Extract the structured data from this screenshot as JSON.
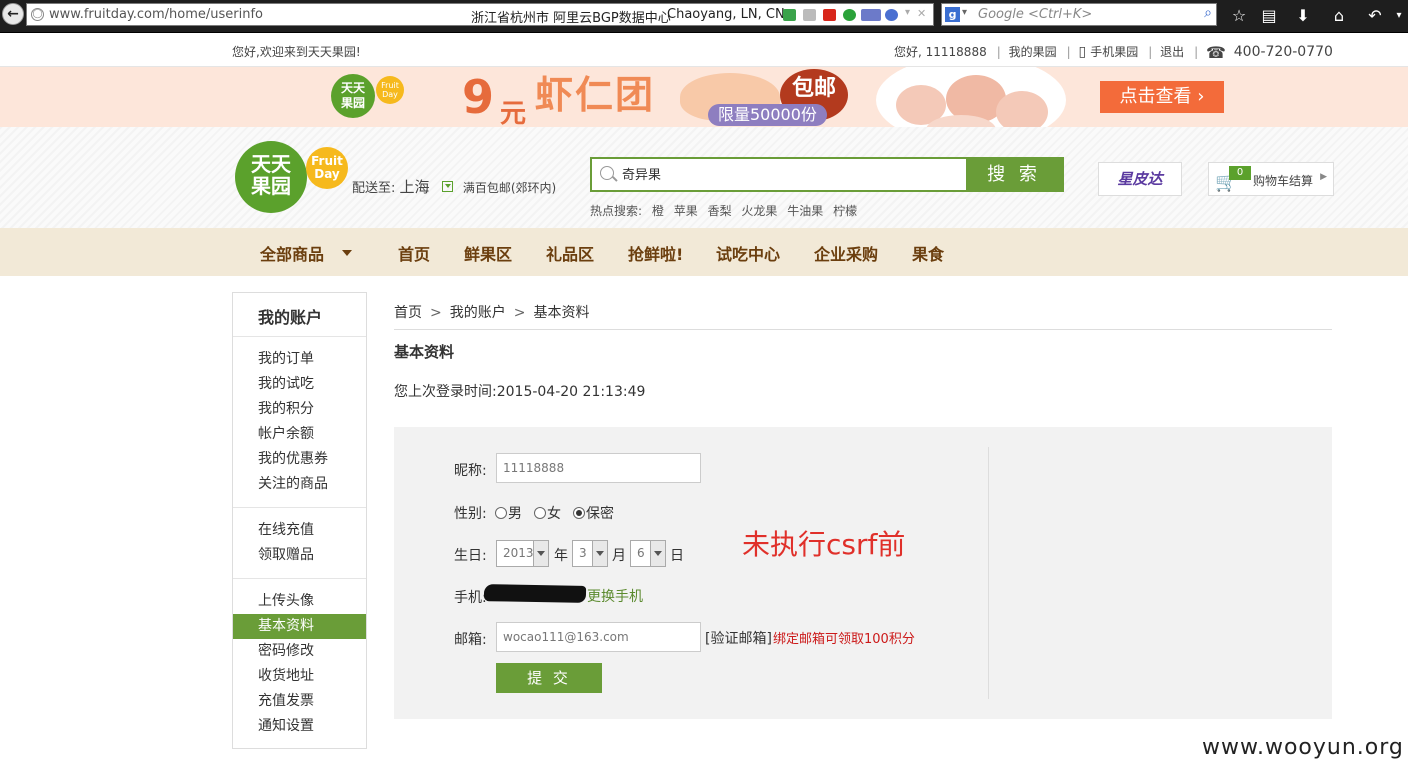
{
  "browser": {
    "url": "www.fruitday.com/home/userinfo",
    "geo_location": "浙江省杭州市 阿里云BGP数据中心",
    "geo_city": "Chaoyang, LN, CN",
    "search_placeholder": "Google <Ctrl+K>"
  },
  "topbar": {
    "welcome": "您好,欢迎来到天天果园!",
    "greeting": "您好, 11118888",
    "my_fruitday": "我的果园",
    "mobile": "手机果园",
    "logout": "退出",
    "hotline": "400-720-0770"
  },
  "banner": {
    "logo_line1": "天天",
    "logo_line2": "果园",
    "logo_badge1": "Fruit",
    "logo_badge2": "Day",
    "price_num": "9",
    "price_unit": "元",
    "title": "虾仁团",
    "free_shipping": "包邮",
    "limit": "限量50000份",
    "cta": "点击查看 ›"
  },
  "header": {
    "logo_line1": "天天",
    "logo_line2": "果园",
    "logo_badge1": "Fruit",
    "logo_badge2": "Day",
    "deliver_label": "配送至:",
    "deliver_city": "上海",
    "deliver_note": "满百包邮(郊环内)",
    "search_value": "奇异果",
    "search_button": "搜 索",
    "hot_label": "热点搜索:",
    "hot_terms": [
      "橙",
      "苹果",
      "香梨",
      "火龙果",
      "牛油果",
      "柠檬"
    ],
    "partner": "星皮达",
    "cart_count": "0",
    "cart_label": "购物车结算"
  },
  "nav": {
    "all": "全部商品",
    "items": [
      "首页",
      "鲜果区",
      "礼品区",
      "抢鲜啦!",
      "试吃中心",
      "企业采购",
      "果食"
    ]
  },
  "sidebar": {
    "title": "我的账户",
    "group1": [
      "我的订单",
      "我的试吃",
      "我的积分",
      "帐户余额",
      "我的优惠券",
      "关注的商品"
    ],
    "group2": [
      "在线充值",
      "领取赠品"
    ],
    "group3": [
      "上传头像",
      "基本资料",
      "密码修改",
      "收货地址",
      "充值发票",
      "通知设置"
    ],
    "active": "基本资料"
  },
  "main": {
    "breadcrumb": [
      "首页",
      "我的账户",
      "基本资料"
    ],
    "page_title": "基本资料",
    "last_login_label": "您上次登录时间:",
    "last_login": "2015-04-20 21:13:49",
    "form": {
      "nickname_label": "昵称:",
      "nickname_value": "11118888",
      "gender_label": "性别:",
      "gender_options": [
        "男",
        "女",
        "保密"
      ],
      "gender_selected": "保密",
      "birthday_label": "生日:",
      "year_value": "2013",
      "year_unit": "年",
      "month_value": "3",
      "month_unit": "月",
      "day_value": "6",
      "day_unit": "日",
      "phone_label": "手机:",
      "change_phone": "更换手机",
      "email_label": "邮箱:",
      "email_value": "wocao111@163.com",
      "verify_email": "[验证邮箱]",
      "bind_note": "绑定邮箱可领取100积分",
      "submit": "提 交"
    },
    "annotation": "未执行csrf前"
  },
  "watermark": "www.wooyun.org",
  "colors": {
    "brand_green": "#6a9d38",
    "nav_bg": "#f2e9d7",
    "nav_text": "#6b3e0e",
    "alert_red": "#cc1a1a",
    "annotation_red": "#e0302a"
  }
}
